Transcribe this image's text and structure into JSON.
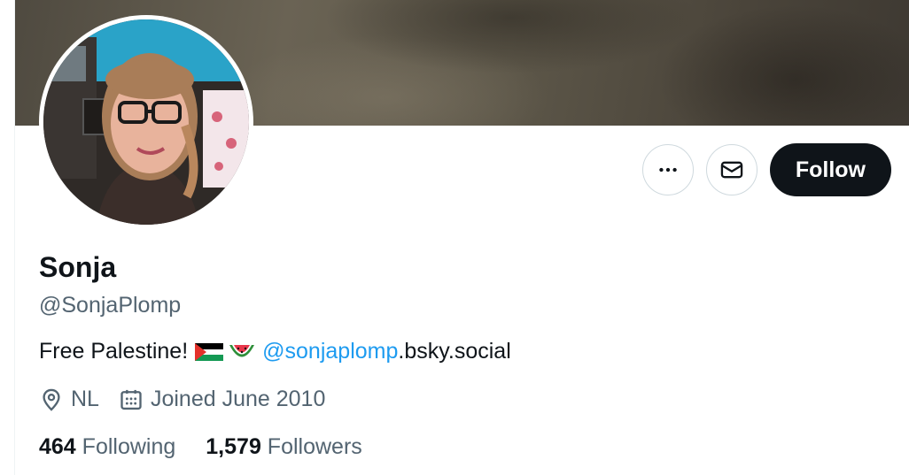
{
  "profile": {
    "name": "Sonja",
    "handle": "@SonjaPlomp",
    "bio": {
      "text": "Free Palestine!",
      "link_highlight": "@sonjaplomp",
      "link_rest": ".bsky.social"
    },
    "location": "NL",
    "joined": "Joined June 2010",
    "following_count": "464",
    "following_label": "Following",
    "followers_count": "1,579",
    "followers_label": "Followers"
  },
  "actions": {
    "more_icon": "more-horizontal-icon",
    "message_icon": "envelope-icon",
    "follow_label": "Follow"
  },
  "colors": {
    "text_primary": "#0f1419",
    "text_secondary": "#536471",
    "link": "#1d9bf0",
    "follow_bg": "#0f1419"
  }
}
